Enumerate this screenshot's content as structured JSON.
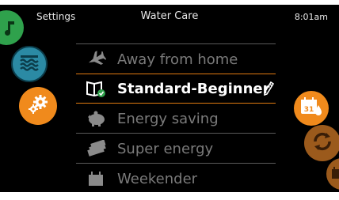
{
  "header": {
    "settings_label": "Settings",
    "title": "Water Care",
    "time": "8:01am"
  },
  "menu": {
    "items": [
      {
        "label": "Away from home",
        "icon": "airplane-icon"
      },
      {
        "label": "Standard-Beginner",
        "icon": "book-check-icon",
        "selected": true
      },
      {
        "label": "Energy saving",
        "icon": "piggy-bank-icon"
      },
      {
        "label": "Super energy",
        "icon": "money-stack-icon"
      },
      {
        "label": "Weekender",
        "icon": "calendar-icon"
      }
    ],
    "edit_icon": "pencil-icon"
  },
  "side_buttons": {
    "left": [
      "home-icon",
      "water-waves-icon",
      "gears-icon"
    ],
    "right": [
      "calendar-drop-icon",
      "sync-icon",
      "extra-icon"
    ]
  },
  "calendar_badge": "31",
  "colors": {
    "accent": "#f08a1c",
    "water": "#2b8aa4",
    "green": "#2fa14c",
    "highlight_line": "#e07a10"
  }
}
